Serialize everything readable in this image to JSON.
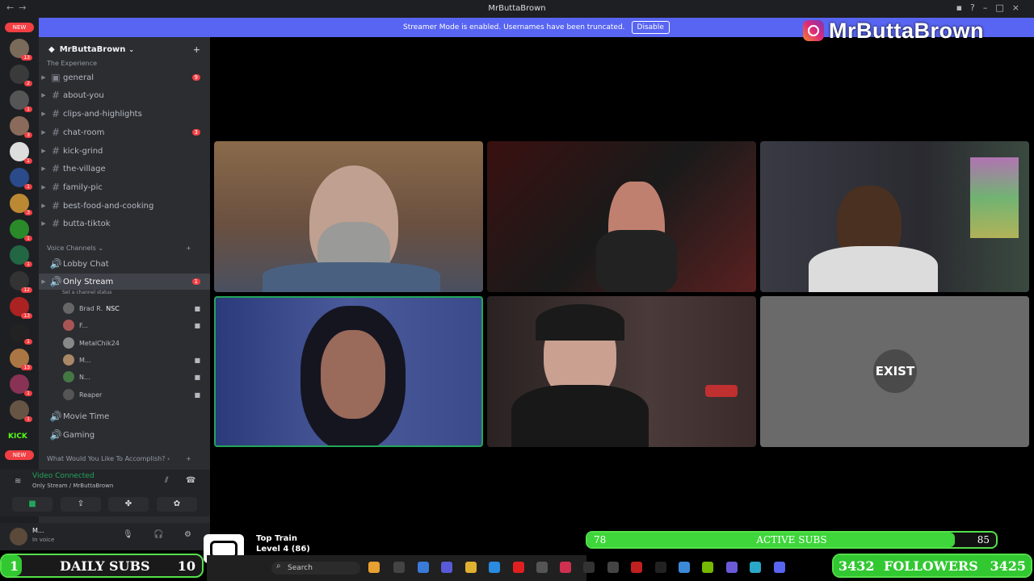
{
  "window": {
    "title": "MrButtaBrown"
  },
  "banner": {
    "text": "Streamer Mode is enabled. Usernames have been truncated.",
    "button": "Disable"
  },
  "overlay": {
    "instagram": "MrButtaBrown"
  },
  "guilds": {
    "new1": "NEW",
    "new2": "NEW",
    "kick": "KICK"
  },
  "server": {
    "name": "MrButtaBrown",
    "category_top": "The Experience"
  },
  "channels": [
    {
      "name": "general",
      "count": "9"
    },
    {
      "name": "about-you",
      "count": ""
    },
    {
      "name": "clips-and-highlights",
      "count": ""
    },
    {
      "name": "chat-room",
      "count": "3"
    },
    {
      "name": "kick-grind",
      "count": ""
    },
    {
      "name": "the-village",
      "count": ""
    },
    {
      "name": "family-pic",
      "count": ""
    },
    {
      "name": "best-food-and-cooking",
      "count": ""
    },
    {
      "name": "butta-tiktok",
      "count": ""
    }
  ],
  "voice": {
    "category": "Voice Channels",
    "lobby": "Lobby Chat",
    "only_stream": "Only Stream",
    "only_stream_count": "1",
    "status_hint": "Set a channel status",
    "users": [
      "Brad R.",
      "F...",
      "MetalChik24",
      "M...",
      "N...",
      "Reaper"
    ],
    "nsc_tag": "NSC",
    "movie": "Movie Time",
    "gaming": "Gaming",
    "category2": "What Would You Like To Accomplish?"
  },
  "connection": {
    "status": "Video Connected",
    "detail": "Only Stream / MrButtaBrown"
  },
  "user": {
    "name": "M...",
    "status": "In voice"
  },
  "tiles": {
    "exist_label": "EXIST"
  },
  "sub_bar": {
    "left": "78",
    "label": "ACTIVE SUBS",
    "right": "85",
    "progress": 0.9
  },
  "daily": {
    "left": "1",
    "label": "DAILY SUBS",
    "right": "10",
    "progress": 0.1
  },
  "followers": {
    "left": "3432",
    "label": "FOLLOWERS",
    "right": "3425",
    "progress": 1.0
  },
  "train": {
    "title": "Top Train",
    "level": "Level 4 (86)"
  },
  "taskbar": {
    "search": "Search"
  }
}
